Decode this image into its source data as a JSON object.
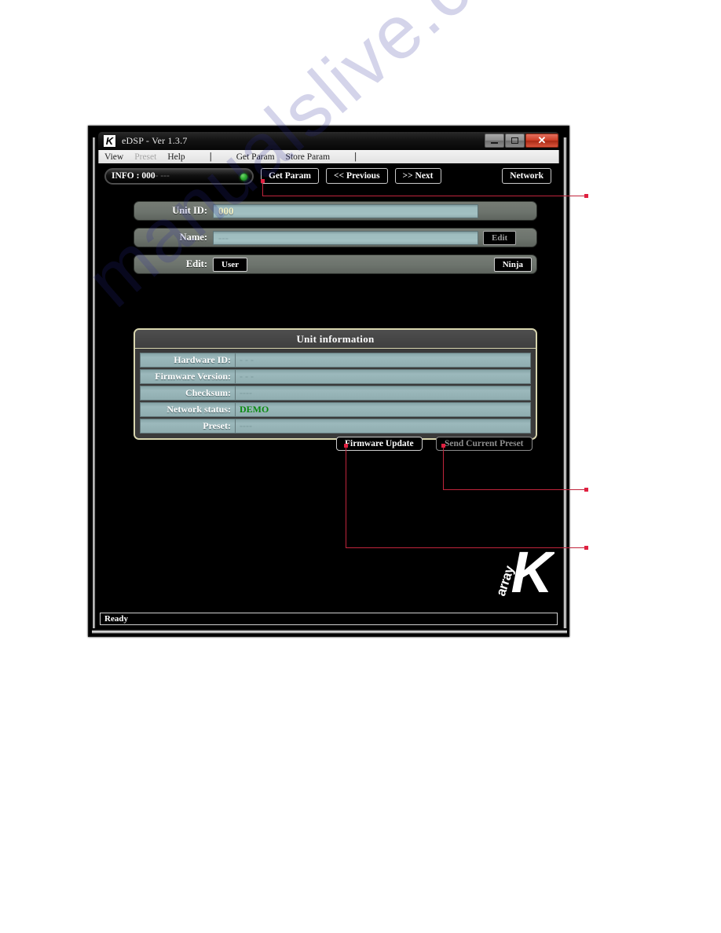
{
  "watermark": {
    "text": "manualslive.com"
  },
  "window": {
    "title": "eDSP - Ver 1.3.7",
    "app_icon": "K",
    "controls": {
      "minimize": "minimize-icon",
      "maximize": "maximize-icon",
      "close": "✕"
    }
  },
  "menu": {
    "items": [
      {
        "label": "View",
        "disabled": false
      },
      {
        "label": "Preset",
        "disabled": true
      },
      {
        "label": "Help",
        "disabled": false
      },
      {
        "label": "|",
        "disabled": false
      },
      {
        "label": "Get Param",
        "disabled": false
      },
      {
        "label": "Store Param",
        "disabled": false
      },
      {
        "label": "|",
        "disabled": false
      }
    ]
  },
  "toolbar": {
    "info_prefix": "INFO : 000",
    "info_suffix": "- ---",
    "led": "status-led-green",
    "get_param": "Get Param",
    "previous": "<< Previous",
    "next": ">> Next",
    "network": "Network"
  },
  "fields": {
    "unit_id": {
      "label": "Unit ID:",
      "value": "000"
    },
    "name": {
      "label": "Name:",
      "value": "---",
      "button": "Edit"
    },
    "edit": {
      "label": "Edit:",
      "current": "User",
      "button": "Ninja"
    }
  },
  "unit_information": {
    "title": "Unit information",
    "rows": [
      {
        "key": "Hardware ID:",
        "value": "- - -",
        "green": false
      },
      {
        "key": "Firmware Version:",
        "value": "- - -",
        "green": false
      },
      {
        "key": "Checksum:",
        "value": "----",
        "green": false
      },
      {
        "key": "Network status:",
        "value": "DEMO",
        "green": true
      },
      {
        "key": "Preset:",
        "value": "----",
        "green": false
      }
    ]
  },
  "actions": {
    "firmware_update": "Firmware Update",
    "send_current_preset": "Send Current Preset"
  },
  "logo": {
    "letter": "K",
    "word": "array"
  },
  "status_bar": {
    "text": "Ready"
  },
  "colors": {
    "accent_red": "#c0253c",
    "panel_border": "#d8d5ae",
    "field_row": "#6d746d",
    "field_value": "#9cb9bc",
    "green_status": "#0a8a10",
    "close_button": "#cf3f28"
  }
}
